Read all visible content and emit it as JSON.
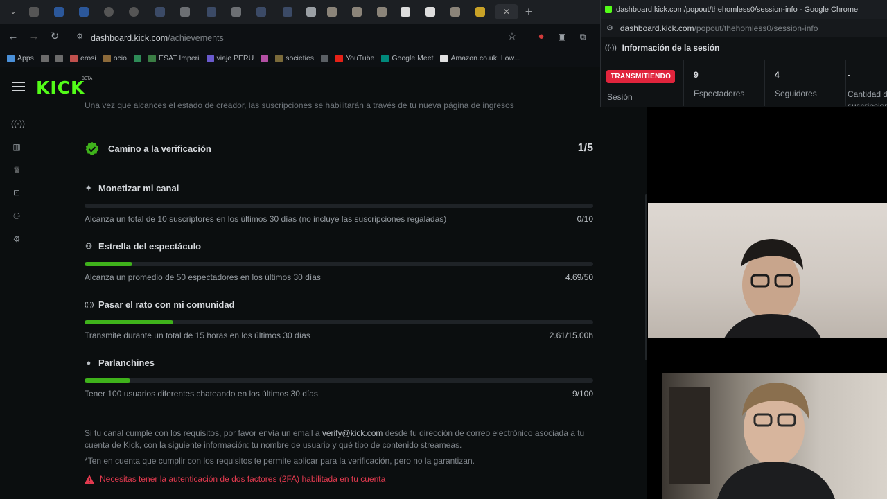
{
  "browser": {
    "url_host": "dashboard.kick.com",
    "url_path": "/achievements",
    "bookmarks": [
      {
        "label": "Apps",
        "color": "#4a90d9"
      },
      {
        "label": "",
        "color": "#6b6b6b"
      },
      {
        "label": "",
        "color": "#6b6b6b"
      },
      {
        "label": "erosi",
        "color": "#c0504d"
      },
      {
        "label": "ocio",
        "color": "#8c6a3a"
      },
      {
        "label": "",
        "color": "#2e8b57"
      },
      {
        "label": "ESAT Imperi",
        "color": "#3a7d44"
      },
      {
        "label": "viaje PERU",
        "color": "#6a5acd"
      },
      {
        "label": "",
        "color": "#b34fa3"
      },
      {
        "label": "societies",
        "color": "#7a6a3a"
      },
      {
        "label": "",
        "color": "#5a5f64"
      },
      {
        "label": "YouTube",
        "color": "#e62117"
      },
      {
        "label": "Google Meet",
        "color": "#00897b"
      },
      {
        "label": "Amazon.co.uk: Low...",
        "color": "#e0e0e0"
      }
    ]
  },
  "kick": {
    "logo": "KICK",
    "beta": "BETA",
    "top_note": "Una vez que alcances el estado de creador, las suscripciones se habilitarán a través de tu nueva página de ingresos",
    "verification": {
      "title": "Camino a la verificación",
      "count": "1/5"
    },
    "goals": [
      {
        "title": "Monetizar mi canal",
        "icon": "sparkle-icon",
        "desc": "Alcanza un total de 10 suscriptores en los últimos 30 días (no incluye las suscripciones regaladas)",
        "value": "0/10",
        "progress": 0.0
      },
      {
        "title": "Estrella del espectáculo",
        "icon": "users-icon",
        "desc": "Alcanza un promedio de 50 espectadores en los últimos 30 días",
        "value": "4.69/50",
        "progress": 0.0938
      },
      {
        "title": "Pasar el rato con mi comunidad",
        "icon": "broadcast-icon",
        "desc": "Transmite durante un total de 15 horas en los últimos 30 días",
        "value": "2.61/15.00h",
        "progress": 0.174
      },
      {
        "title": "Parlanchines",
        "icon": "chat-icon",
        "desc": "Tener 100 usuarios diferentes chateando en los últimos 30 días",
        "value": "9/100",
        "progress": 0.09
      }
    ],
    "info_pre": "Si tu canal cumple con los requisitos, por favor envía un email a ",
    "info_email": "verify@kick.com",
    "info_post": " desde tu dirección de correo electrónico asociada a tu cuenta de Kick, con la siguiente información: tu nombre de usuario y qué tipo de contenido streameas.",
    "info_note": "*Ten en cuenta que cumplir con los requisitos te permite aplicar para la verificación, pero no la garantizan.",
    "warning": "Necesitas tener la autenticación de dos factores (2FA) habilitada en tu cuenta"
  },
  "popout": {
    "window_title": "dashboard.kick.com/popout/thehomless0/session-info - Google Chrome",
    "url_host": "dashboard.kick.com",
    "url_path": "/popout/thehomless0/session-info",
    "header": "Información de la sesión",
    "live_badge": "TRANSMITIENDO",
    "session_label": "Sesión",
    "stats": [
      {
        "num": "9",
        "label": "Espectadores"
      },
      {
        "num": "4",
        "label": "Seguidores"
      },
      {
        "num": "-",
        "label": "Cantidad de suscripciones"
      }
    ]
  },
  "colors": {
    "kick_green": "#53fc18",
    "progress_green": "#3fb21b",
    "live_red": "#e0243c",
    "warning_red": "#e23a4f"
  }
}
